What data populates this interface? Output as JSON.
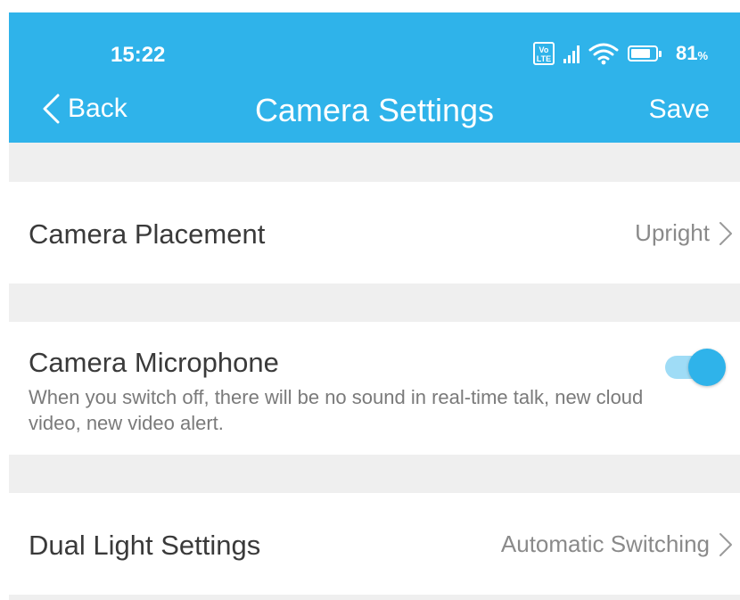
{
  "status_bar": {
    "time": "15:22",
    "volte_top": "Vo",
    "volte_bottom": "LTE",
    "battery_percent": "81",
    "battery_unit": "%"
  },
  "nav": {
    "back_label": "Back",
    "title": "Camera Settings",
    "save_label": "Save"
  },
  "settings": {
    "placement": {
      "label": "Camera Placement",
      "value": "Upright"
    },
    "microphone": {
      "label": "Camera Microphone",
      "description": "When you switch off, there will be no sound in real-time talk, new cloud video, new video alert.",
      "enabled": true
    },
    "dual_light": {
      "label": "Dual Light Settings",
      "value": "Automatic Switching"
    }
  },
  "colors": {
    "accent": "#2fb3ea",
    "toggle_track": "#9fdcf6",
    "page_background": "#efefef"
  }
}
